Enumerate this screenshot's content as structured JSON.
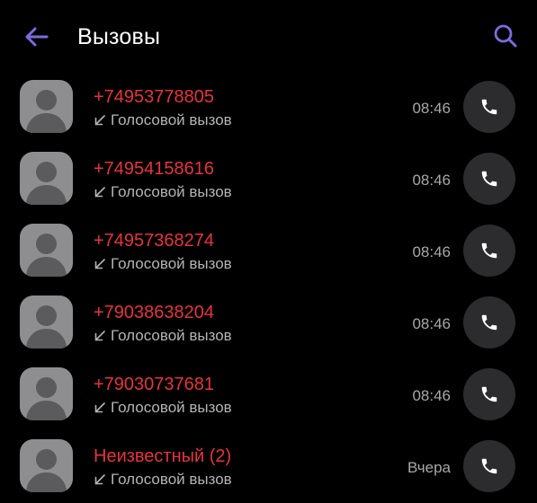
{
  "header": {
    "title": "Вызовы",
    "back_icon": "arrow-left-icon",
    "search_icon": "search-icon"
  },
  "colors": {
    "background": "#000000",
    "accent": "#7c6ce0",
    "missed_call_text": "#e8323f",
    "secondary_text": "#b4b4b8",
    "call_button_bg": "#2c2c2e",
    "avatar_bg": "#8e8e91"
  },
  "calls": [
    {
      "name": "+74953778805",
      "type": "Голосовой вызов",
      "time": "08:46",
      "direction_icon": "incoming-arrow-icon",
      "action_icon": "phone-icon"
    },
    {
      "name": "+74954158616",
      "type": "Голосовой вызов",
      "time": "08:46",
      "direction_icon": "incoming-arrow-icon",
      "action_icon": "phone-icon"
    },
    {
      "name": "+74957368274",
      "type": "Голосовой вызов",
      "time": "08:46",
      "direction_icon": "incoming-arrow-icon",
      "action_icon": "phone-icon"
    },
    {
      "name": "+79038638204",
      "type": "Голосовой вызов",
      "time": "08:46",
      "direction_icon": "incoming-arrow-icon",
      "action_icon": "phone-icon"
    },
    {
      "name": "+79030737681",
      "type": "Голосовой вызов",
      "time": "08:46",
      "direction_icon": "incoming-arrow-icon",
      "action_icon": "phone-icon"
    },
    {
      "name": "Неизвестный (2)",
      "type": "Голосовой вызов",
      "time": "Вчера",
      "direction_icon": "incoming-arrow-icon",
      "action_icon": "phone-icon"
    }
  ]
}
